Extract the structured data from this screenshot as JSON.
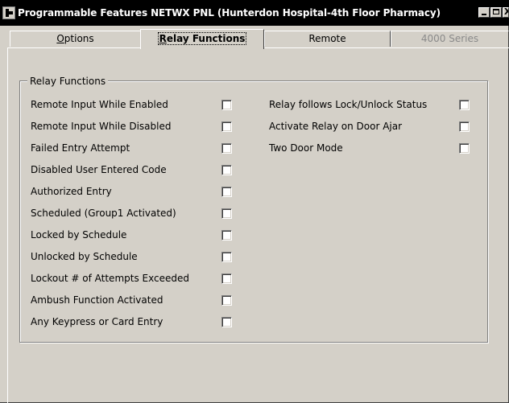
{
  "window": {
    "title": "Programmable Features NETWX PNL (Hunterdon Hospital-4th Floor Pharmacy)"
  },
  "titlebar_icons": [
    "app-icon",
    "minimize-icon",
    "maximize-icon",
    "close-icon"
  ],
  "tabs": [
    {
      "label": "Options",
      "mnemonic": "O",
      "state": "normal"
    },
    {
      "label": "Relay Functions",
      "mnemonic": "R",
      "state": "active"
    },
    {
      "label": "Remote",
      "state": "normal"
    },
    {
      "label": "4000 Series",
      "state": "disabled"
    }
  ],
  "group": {
    "title": "Relay Functions",
    "left_items": [
      {
        "label": "Remote Input While Enabled",
        "checked": false
      },
      {
        "label": "Remote Input While Disabled",
        "checked": false
      },
      {
        "label": "Failed Entry Attempt",
        "checked": false
      },
      {
        "label": "Disabled User Entered Code",
        "checked": false
      },
      {
        "label": "Authorized Entry",
        "checked": false
      },
      {
        "label": "Scheduled (Group1 Activated)",
        "checked": false
      },
      {
        "label": "Locked by Schedule",
        "checked": false
      },
      {
        "label": "Unlocked by Schedule",
        "checked": false
      },
      {
        "label": "Lockout # of Attempts Exceeded",
        "checked": false
      },
      {
        "label": "Ambush Function Activated",
        "checked": false
      },
      {
        "label": "Any Keypress or Card Entry",
        "checked": false
      }
    ],
    "right_items": [
      {
        "label": "Relay follows Lock/Unlock Status",
        "checked": false
      },
      {
        "label": "Activate Relay on Door Ajar",
        "checked": false
      },
      {
        "label": "Two Door Mode",
        "checked": false
      }
    ]
  }
}
